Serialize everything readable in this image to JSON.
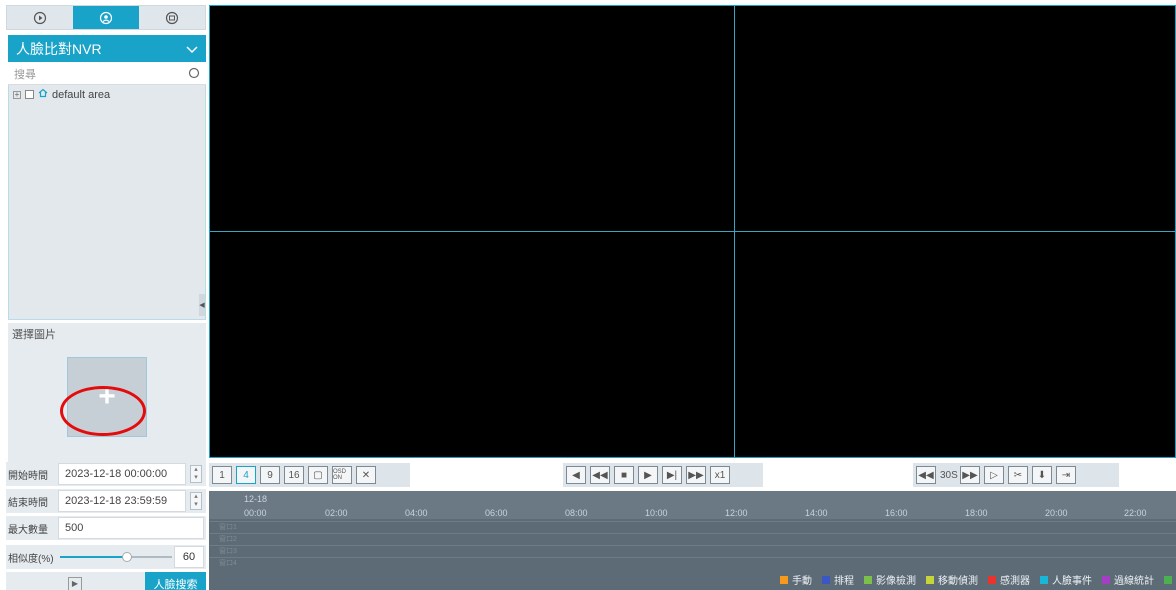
{
  "left_panel": {
    "mode_tabs": [
      {
        "icon": "playback-icon"
      },
      {
        "icon": "face-icon"
      },
      {
        "icon": "record-search-icon"
      }
    ],
    "device": "人臉比對NVR",
    "search_placeholder": "搜尋",
    "tree": {
      "area": "default area"
    },
    "select_picture_label": "選擇圖片",
    "start_time_label": "開始時間",
    "start_time": "2023-12-18 00:00:00",
    "end_time_label": "結束時間",
    "end_time": "2023-12-18 23:59:59",
    "max_count_label": "最大數量",
    "max_count": "500",
    "similarity_label": "相似度(%)",
    "similarity": "60",
    "similarity_fraction": 0.6,
    "face_search_button": "人臉搜索"
  },
  "toolbar": {
    "layout_buttons": [
      "1",
      "4",
      "9",
      "16"
    ],
    "selected_layout": "4",
    "osd": "OSD ON",
    "speed_label": "x1",
    "skip_label": "30S"
  },
  "timeline": {
    "date": "12-18",
    "ticks": [
      "00:00",
      "02:00",
      "04:00",
      "06:00",
      "08:00",
      "10:00",
      "12:00",
      "14:00",
      "16:00",
      "18:00",
      "20:00",
      "22:00"
    ],
    "channels": [
      "窗口1",
      "窗口2",
      "窗口3",
      "窗口4"
    ]
  },
  "legend": [
    {
      "label": "手動",
      "color": "#f59a1b"
    },
    {
      "label": "排程",
      "color": "#3b57c4"
    },
    {
      "label": "影像檢測",
      "color": "#7cc04b"
    },
    {
      "label": "移動偵測",
      "color": "#c7d43a"
    },
    {
      "label": "感測器",
      "color": "#e8332f"
    },
    {
      "label": "人臉事件",
      "color": "#1ab6d8"
    },
    {
      "label": "過線統計",
      "color": "#a43ec2"
    },
    {
      "label": "",
      "color": "#4caf50"
    }
  ]
}
